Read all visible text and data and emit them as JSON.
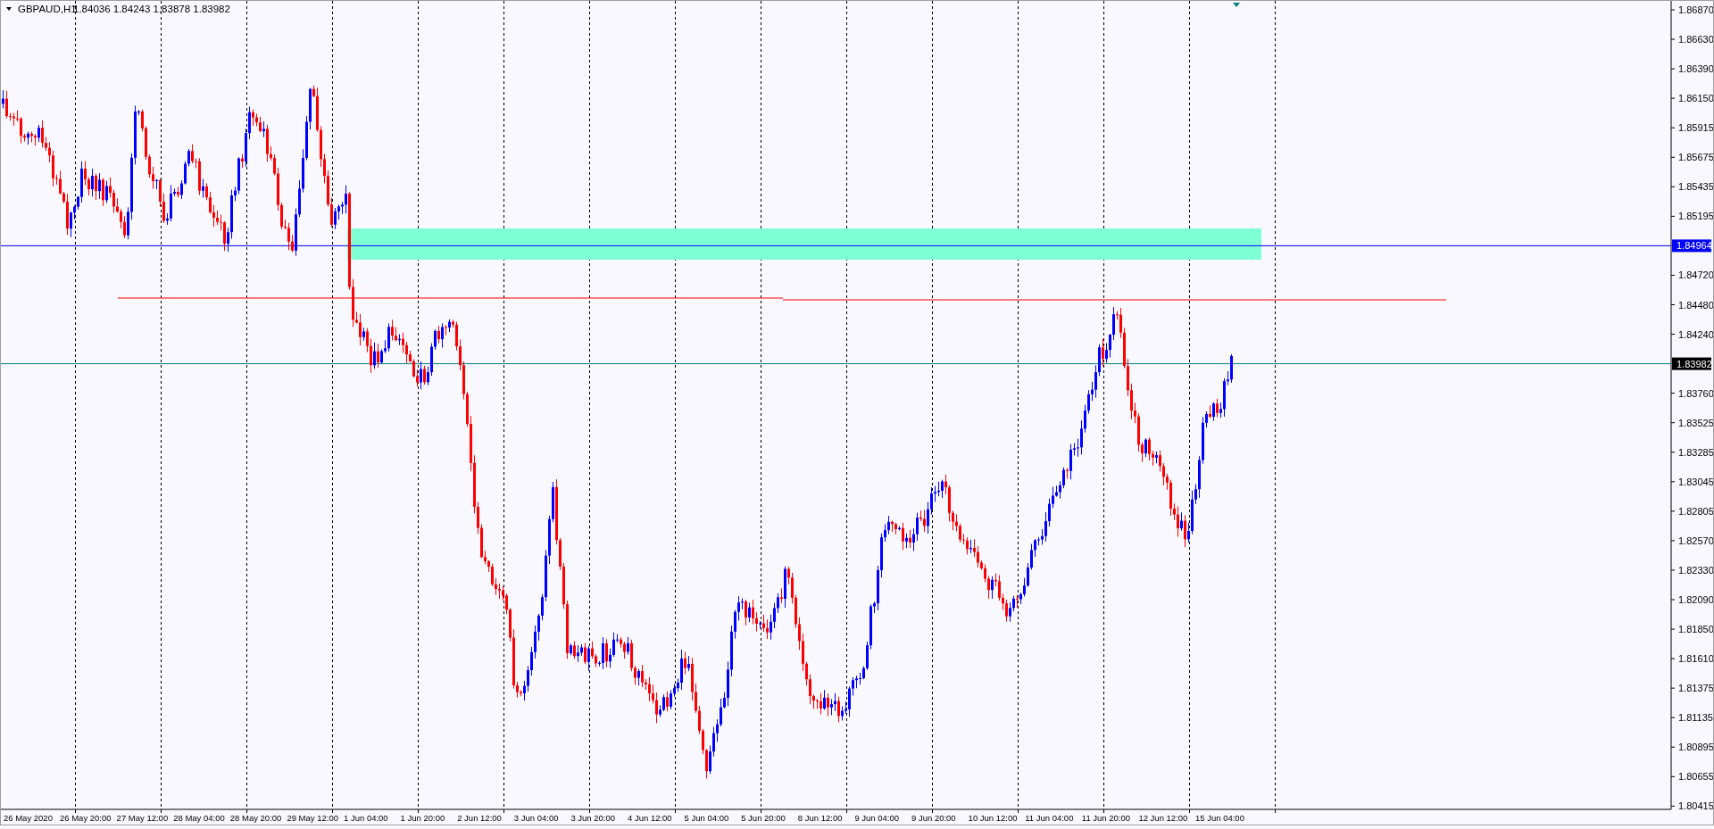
{
  "chart": {
    "symbol": "GBPAUD,H1",
    "ohlc": "1.84036 1.84243 1.83878 1.83982"
  },
  "price_axis": {
    "items": [
      {
        "kind": "tick",
        "text": "1.86870"
      },
      {
        "kind": "tick",
        "text": "1.86630"
      },
      {
        "kind": "tick",
        "text": "1.86390"
      },
      {
        "kind": "tick",
        "text": "1.86150"
      },
      {
        "kind": "tick",
        "text": "1.85915"
      },
      {
        "kind": "tick",
        "text": "1.85675"
      },
      {
        "kind": "tick",
        "text": "1.85435"
      },
      {
        "kind": "tick",
        "text": "1.85195"
      },
      {
        "kind": "tag",
        "text": "1.84964",
        "color": "#0000ff"
      },
      {
        "kind": "tick",
        "text": "1.84720"
      },
      {
        "kind": "tick",
        "text": "1.84480"
      },
      {
        "kind": "tick",
        "text": "1.84240"
      },
      {
        "kind": "tag",
        "text": "1.83982",
        "color": "#000000"
      },
      {
        "kind": "tick",
        "text": "1.83760"
      },
      {
        "kind": "tick",
        "text": "1.83525"
      },
      {
        "kind": "tick",
        "text": "1.83285"
      },
      {
        "kind": "tick",
        "text": "1.83045"
      },
      {
        "kind": "tick",
        "text": "1.82805"
      },
      {
        "kind": "tick",
        "text": "1.82570"
      },
      {
        "kind": "tick",
        "text": "1.82330"
      },
      {
        "kind": "tick",
        "text": "1.82090"
      },
      {
        "kind": "tick",
        "text": "1.81850"
      },
      {
        "kind": "tick",
        "text": "1.81610"
      },
      {
        "kind": "tick",
        "text": "1.81375"
      },
      {
        "kind": "tick",
        "text": "1.81135"
      },
      {
        "kind": "tick",
        "text": "1.80895"
      },
      {
        "kind": "tick",
        "text": "1.80655"
      },
      {
        "kind": "tick",
        "text": "1.80415"
      }
    ]
  },
  "time_axis": {
    "labels": [
      "26 May 2020",
      "26 May 20:00",
      "27 May 12:00",
      "28 May 04:00",
      "28 May 20:00",
      "29 May 12:00",
      "1 Jun 04:00",
      "1 Jun 20:00",
      "2 Jun 12:00",
      "3 Jun 04:00",
      "3 Jun 20:00",
      "4 Jun 12:00",
      "5 Jun 04:00",
      "5 Jun 20:00",
      "8 Jun 12:00",
      "9 Jun 04:00",
      "9 Jun 20:00",
      "10 Jun 12:00",
      "11 Jun 04:00",
      "11 Jun 20:00",
      "12 Jun 12:00",
      "15 Jun 04:00"
    ]
  }
}
